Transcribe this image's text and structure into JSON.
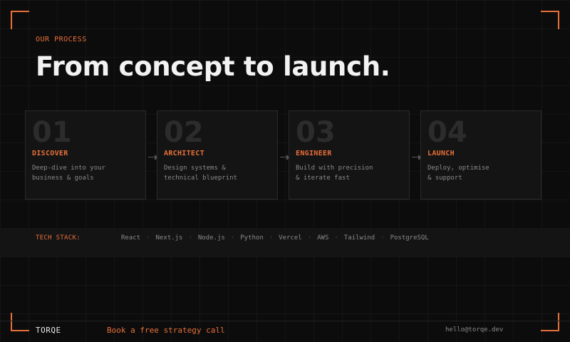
{
  "section": {
    "eyebrow": "OUR PROCESS",
    "headline": "From concept to launch."
  },
  "steps": [
    {
      "number": "01",
      "title": "DISCOVER",
      "desc": [
        "Deep-dive into your",
        "business & goals"
      ]
    },
    {
      "number": "02",
      "title": "ARCHITECT",
      "desc": [
        "Design systems &",
        "technical blueprint"
      ]
    },
    {
      "number": "03",
      "title": "ENGINEER",
      "desc": [
        "Build with precision",
        "& iterate fast"
      ]
    },
    {
      "number": "04",
      "title": "LAUNCH",
      "desc": [
        "Deploy, optimise",
        "& support"
      ]
    }
  ],
  "tech_stack": {
    "label": "TECH STACK:",
    "separator": "·",
    "items": [
      "React",
      "Next.js",
      "Node.js",
      "Python",
      "Vercel",
      "AWS",
      "Tailwind",
      "PostgreSQL"
    ]
  },
  "footer": {
    "brand": "TORQE",
    "cta": "Book a free strategy call",
    "email": "hello@torqe.dev"
  },
  "colors": {
    "accent": "#e8703a",
    "background": "#0c0c0c",
    "card": "#141414",
    "muted_text": "#8a8a8a"
  }
}
